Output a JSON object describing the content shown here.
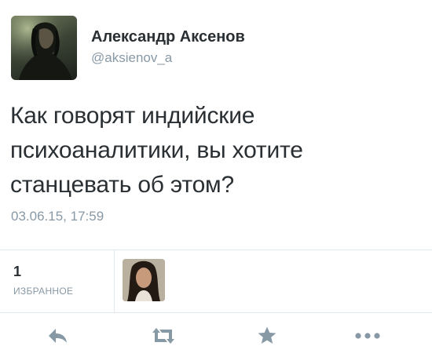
{
  "tweet": {
    "author_name": "Александр Аксенов",
    "author_handle": "@aksienov_a",
    "text_lines": [
      "Как говорят индийские",
      "психоаналитики, вы хотите",
      "станцевать об этом?"
    ],
    "timestamp": "03.06.15, 17:59"
  },
  "stats": {
    "favorites_count": "1",
    "favorites_label": "ИЗБРАННОЕ"
  },
  "actions": {
    "icons": [
      "reply-icon",
      "retweet-icon",
      "favorite-icon",
      "more-icon"
    ]
  },
  "colors": {
    "text": "#292f33",
    "secondary_text": "#8899a6",
    "divider": "#e1e8ed",
    "action_icon": "#8899a6"
  }
}
